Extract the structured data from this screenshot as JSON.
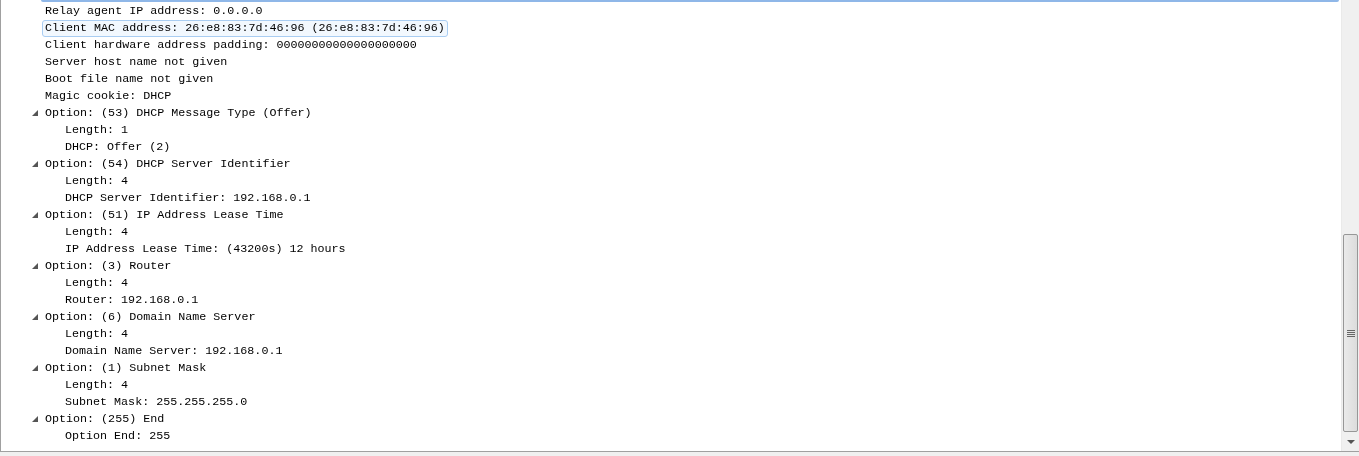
{
  "tree": [
    {
      "label": "Relay agent IP address: 0.0.0.0",
      "selected": false
    },
    {
      "label": "Client MAC address: 26:e8:83:7d:46:96 (26:e8:83:7d:46:96)",
      "selected": true
    },
    {
      "label": "Client hardware address padding: 00000000000000000000",
      "selected": false
    },
    {
      "label": "Server host name not given",
      "selected": false
    },
    {
      "label": "Boot file name not given",
      "selected": false
    },
    {
      "label": "Magic cookie: DHCP",
      "selected": false
    },
    {
      "label": "Option: (53) DHCP Message Type (Offer)",
      "selected": false,
      "expanded": true,
      "children": [
        {
          "label": "Length: 1",
          "selected": false
        },
        {
          "label": "DHCP: Offer (2)",
          "selected": false
        }
      ]
    },
    {
      "label": "Option: (54) DHCP Server Identifier",
      "selected": false,
      "expanded": true,
      "children": [
        {
          "label": "Length: 4",
          "selected": false
        },
        {
          "label": "DHCP Server Identifier: 192.168.0.1",
          "selected": false
        }
      ]
    },
    {
      "label": "Option: (51) IP Address Lease Time",
      "selected": false,
      "expanded": true,
      "children": [
        {
          "label": "Length: 4",
          "selected": false
        },
        {
          "label": "IP Address Lease Time: (43200s) 12 hours",
          "selected": false
        }
      ]
    },
    {
      "label": "Option: (3) Router",
      "selected": false,
      "expanded": true,
      "children": [
        {
          "label": "Length: 4",
          "selected": false
        },
        {
          "label": "Router: 192.168.0.1",
          "selected": false
        }
      ]
    },
    {
      "label": "Option: (6) Domain Name Server",
      "selected": false,
      "expanded": true,
      "children": [
        {
          "label": "Length: 4",
          "selected": false
        },
        {
          "label": "Domain Name Server: 192.168.0.1",
          "selected": false
        }
      ]
    },
    {
      "label": "Option: (1) Subnet Mask",
      "selected": false,
      "expanded": true,
      "children": [
        {
          "label": "Length: 4",
          "selected": false
        },
        {
          "label": "Subnet Mask: 255.255.255.0",
          "selected": false
        }
      ]
    },
    {
      "label": "Option: (255) End",
      "selected": false,
      "expanded": true,
      "children": [
        {
          "label": "Option End: 255",
          "selected": false
        }
      ]
    }
  ]
}
